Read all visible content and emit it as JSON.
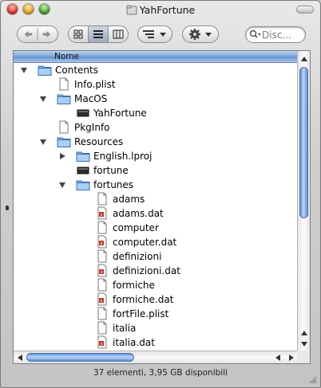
{
  "window": {
    "title": "YahFortune"
  },
  "toolbar": {
    "back_icon": "back-arrow-icon",
    "forward_icon": "forward-arrow-icon",
    "view_icons": [
      "icon-view-icon",
      "list-view-icon",
      "column-view-icon"
    ],
    "selected_view": "list",
    "search_placeholder": "Disc..."
  },
  "list": {
    "column_header": "Nome",
    "rows": [
      {
        "label": "Contents",
        "level": 0,
        "kind": "folder",
        "disclosure": "open"
      },
      {
        "label": "Info.plist",
        "level": 1,
        "kind": "document",
        "disclosure": "none"
      },
      {
        "label": "MacOS",
        "level": 1,
        "kind": "folder",
        "disclosure": "open"
      },
      {
        "label": "YahFortune",
        "level": 2,
        "kind": "executable",
        "disclosure": "none"
      },
      {
        "label": "PkgInfo",
        "level": 1,
        "kind": "document",
        "disclosure": "none"
      },
      {
        "label": "Resources",
        "level": 1,
        "kind": "folder",
        "disclosure": "open"
      },
      {
        "label": "English.lproj",
        "level": 2,
        "kind": "folder",
        "disclosure": "closed"
      },
      {
        "label": "fortune",
        "level": 2,
        "kind": "executable",
        "disclosure": "none"
      },
      {
        "label": "fortunes",
        "level": 2,
        "kind": "folder",
        "disclosure": "open"
      },
      {
        "label": "adams",
        "level": 3,
        "kind": "document",
        "disclosure": "none"
      },
      {
        "label": "adams.dat",
        "level": 3,
        "kind": "dat",
        "disclosure": "none"
      },
      {
        "label": "computer",
        "level": 3,
        "kind": "document",
        "disclosure": "none"
      },
      {
        "label": "computer.dat",
        "level": 3,
        "kind": "dat",
        "disclosure": "none"
      },
      {
        "label": "definizioni",
        "level": 3,
        "kind": "document",
        "disclosure": "none"
      },
      {
        "label": "definizioni.dat",
        "level": 3,
        "kind": "dat",
        "disclosure": "none"
      },
      {
        "label": "formiche",
        "level": 3,
        "kind": "document",
        "disclosure": "none"
      },
      {
        "label": "formiche.dat",
        "level": 3,
        "kind": "dat",
        "disclosure": "none"
      },
      {
        "label": "fortFile.plist",
        "level": 3,
        "kind": "document",
        "disclosure": "none"
      },
      {
        "label": "italia",
        "level": 3,
        "kind": "document",
        "disclosure": "none"
      },
      {
        "label": "italia.dat",
        "level": 3,
        "kind": "dat",
        "disclosure": "none"
      }
    ]
  },
  "status": {
    "text": "37 elementi, 3,95 GB disponibili"
  },
  "colors": {
    "selection_blue": "#6593d2",
    "scroll_blue": "#5d8fd6",
    "folder_blue": "#7fb3ec"
  }
}
